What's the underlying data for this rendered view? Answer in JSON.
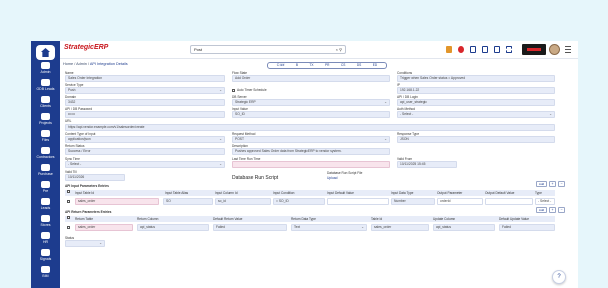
{
  "app": {
    "logo": "StrategicERP",
    "logo_sub": "",
    "search_value": "Post",
    "search_close": "×",
    "search_icon": "search-icon"
  },
  "breadcrumb": {
    "home": "Home",
    "sep1": "/",
    "mid": "Admin",
    "sep2": "/",
    "current": "API Integration Details"
  },
  "formatbar": [
    "C:\\##",
    "B",
    "TX",
    "PR",
    "CS",
    "DS",
    "ED"
  ],
  "sidebar": [
    {
      "label": "Admin"
    },
    {
      "label": "ODB Leads"
    },
    {
      "label": "Clients"
    },
    {
      "label": "Projects"
    },
    {
      "label": "Files"
    },
    {
      "label": "Contractors"
    },
    {
      "label": "Purchase"
    },
    {
      "label": "Pre"
    },
    {
      "label": "Leads"
    },
    {
      "label": "Stores"
    },
    {
      "label": "HR"
    },
    {
      "label": "Signals"
    },
    {
      "label": "BIM"
    }
  ],
  "form": {
    "name_label": "Name",
    "name_value": "Sales Order Integration",
    "flow_state_label": "Flow State",
    "flow_state_value": "Add Order",
    "conditions_label": "Conditions",
    "conditions_value": "Trigger when Sales Order status = Approved",
    "service_type_label": "Service Type",
    "service_type_value": "Push",
    "auto_timer_label": "Auto Timer Schedule",
    "ip_label": "IP",
    "ip_value": "192.168.1.22",
    "domain_label": "Domain",
    "domain_value": "3432",
    "db_server_label": "DB Server",
    "db_server_value": "Strategic ERP",
    "api_db_login_label": "API / DB Login",
    "api_db_login_value": "api_user_strategic",
    "api_password_label": "API / DB Password",
    "api_password_value": "••••••",
    "input_value_label": "Input Value",
    "input_value_value": "SO_ID",
    "auth_method_label": "Auth Method",
    "auth_method_value": "- Select -",
    "url_label": "URL",
    "url_value": "https://api.vendor.example.com/v1/salesorder/create",
    "content_type_label": "Content Type of Input",
    "content_type_value": "application/json",
    "request_method_label": "Request Method",
    "request_method_value": "POST",
    "response_type_label": "Response Type",
    "response_type_value": "JSON",
    "return_status_label": "Return Status",
    "return_status_value": "Success / Error",
    "description_label": "Description",
    "description_value": "Pushes approved Sales Order data from StrategicERP to vendor system.",
    "sync_type_label": "Sync Time",
    "sync_type_value": "- Select -",
    "last_time_run_label": "Last Time Run Time",
    "last_time_run_value": "",
    "valid_from_label": "Valid From",
    "valid_from_value": "10/11/2025 15:45",
    "valid_till_label": "Valid Till",
    "valid_till_value": "10/11/2026",
    "db_run_script_label": "Database Run Script",
    "db_run_script2_label": "Database Run Script File",
    "db_run_script2_link": "Upload"
  },
  "api_input": {
    "title": "API Input Parameters Entries",
    "add_label": "Add",
    "plus": "+",
    "minus": "−",
    "columns": [
      "Input Table Id",
      "Input Table Alias",
      "Input Column Id",
      "Input Condition",
      "Input Default Value",
      "Input Data Type",
      "Output Parameter",
      "Output Default Value",
      "Type"
    ],
    "row": [
      "sales_order",
      "SO",
      "so_id",
      "= SO_ID",
      "",
      "Number",
      "orderId",
      "",
      "- Select -"
    ]
  },
  "api_return": {
    "title": "API Return Parameters Entries",
    "add_label": "Add",
    "plus": "+",
    "minus": "−",
    "columns": [
      "Return Table",
      "Return Column",
      "Default Return Value",
      "Return Data Type",
      "Table Id",
      "Update Column",
      "Default Update Value"
    ],
    "row": [
      "sales_order",
      "api_status",
      "Failed",
      "Text",
      "sales_order",
      "api_status",
      "Failed"
    ]
  },
  "status_label": "Status",
  "fab_icon": "chat-icon"
}
